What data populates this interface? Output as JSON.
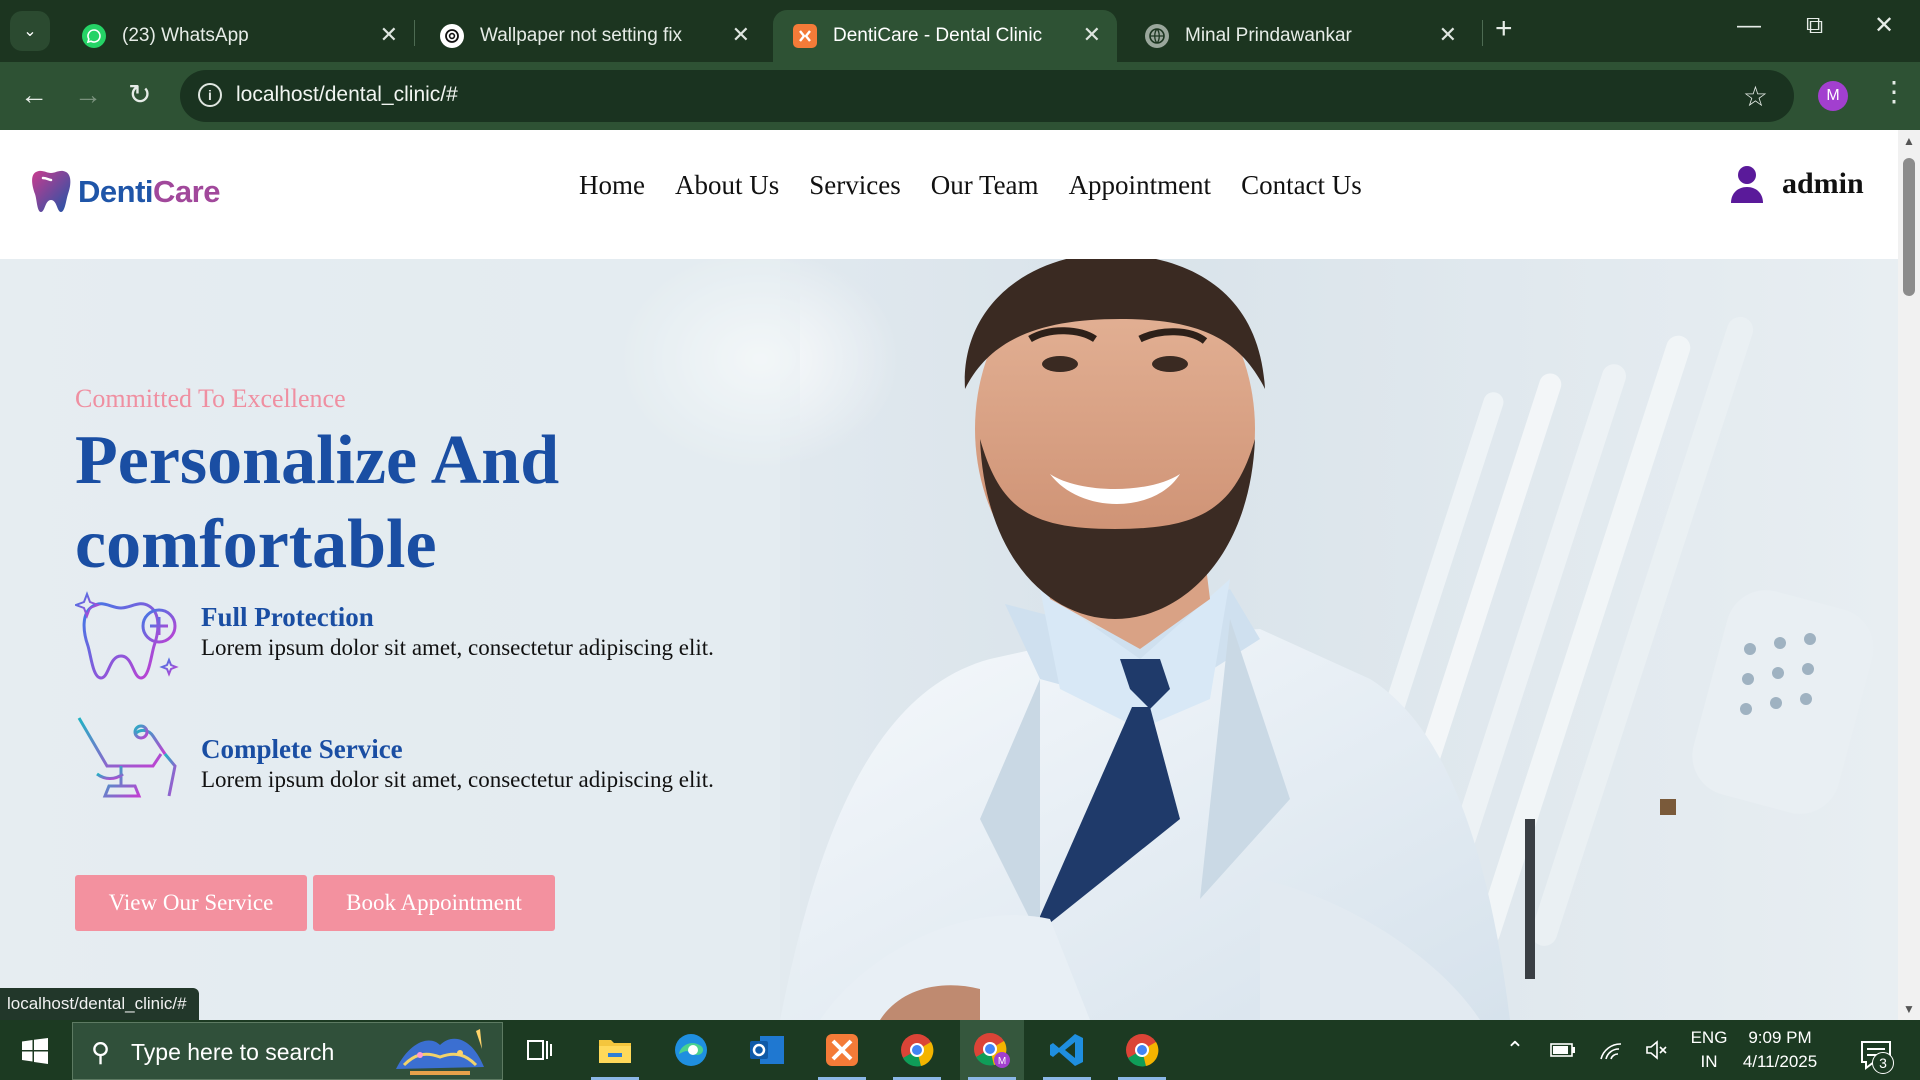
{
  "browser": {
    "tabs": [
      {
        "title": "(23) WhatsApp",
        "icon": "whatsapp-icon",
        "active": false
      },
      {
        "title": "Wallpaper not setting fix",
        "icon": "chatgpt-icon",
        "active": false
      },
      {
        "title": "DentiCare - Dental Clinic",
        "icon": "xampp-icon",
        "active": true
      },
      {
        "title": "Minal Prindawankar",
        "icon": "globe-icon",
        "active": false
      }
    ],
    "url": "localhost/dental_clinic/#",
    "profile_initial": "M",
    "status_url": "localhost/dental_clinic/#"
  },
  "site": {
    "logo": {
      "part1": "Denti",
      "part2": "Care"
    },
    "nav": [
      "Home",
      "About Us",
      "Services",
      "Our Team",
      "Appointment",
      "Contact Us"
    ],
    "user": {
      "name": "admin",
      "icon": "user-icon"
    },
    "accent_colors": {
      "primary": "#1a4ea3",
      "pink": "#f3919f",
      "logo_purple": "#a1489b"
    }
  },
  "hero": {
    "tagline": "Committed To Excellence",
    "title": "Personalize And comfortable",
    "features": [
      {
        "title": "Full Protection",
        "desc": "Lorem ipsum dolor sit amet, consectetur adipiscing elit.",
        "icon": "tooth-plus-icon"
      },
      {
        "title": "Complete Service",
        "desc": "Lorem ipsum dolor sit amet, consectetur adipiscing elit.",
        "icon": "dental-chair-icon"
      }
    ],
    "buttons": {
      "service": "View Our Service",
      "appointment": "Book Appointment"
    }
  },
  "taskbar": {
    "search_placeholder": "Type here to search",
    "apps": [
      "task-view-icon",
      "file-explorer-icon",
      "edge-icon",
      "outlook-icon",
      "xampp-icon",
      "chrome-icon",
      "chrome-profile-icon",
      "vscode-icon",
      "chrome-icon"
    ],
    "language": {
      "line1": "ENG",
      "line2": "IN"
    },
    "time": "9:09 PM",
    "date": "4/11/2025",
    "notification_count": "3"
  }
}
